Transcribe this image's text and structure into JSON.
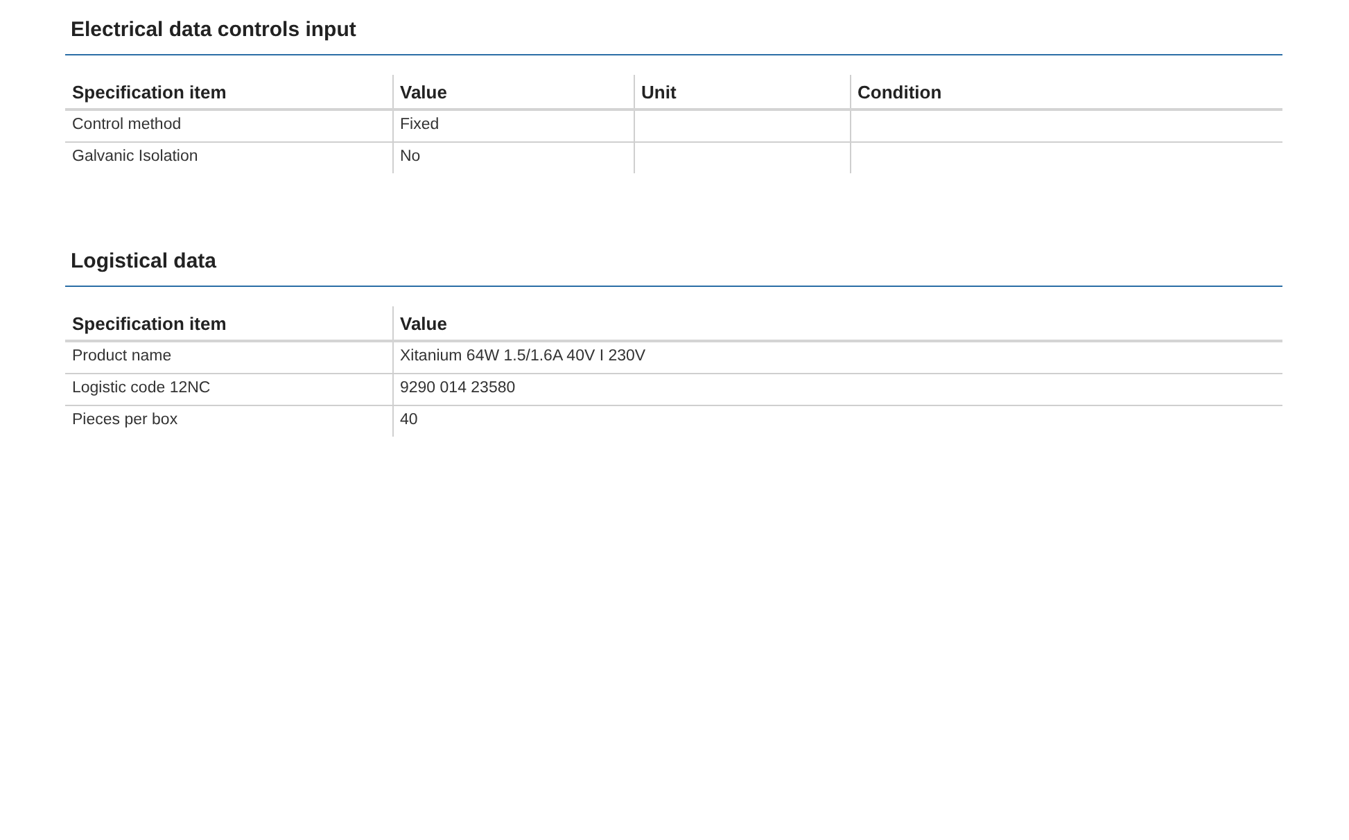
{
  "sections": [
    {
      "title": "Electrical data controls input",
      "table": {
        "columns": [
          "Specification item",
          "Value",
          "Unit",
          "Condition"
        ],
        "rows": [
          [
            "Control method",
            "Fixed"
          ],
          [
            "Galvanic Isolation",
            "No"
          ]
        ]
      }
    },
    {
      "title": "Logistical data",
      "table": {
        "columns": [
          "Specification item",
          "Value"
        ],
        "rows": [
          [
            "Product name",
            "Xitanium 64W 1.5/1.6A 40V I 230V"
          ],
          [
            "Logistic code 12NC",
            "9290 014 23580"
          ],
          [
            "Pieces per box",
            "40"
          ]
        ]
      }
    }
  ]
}
